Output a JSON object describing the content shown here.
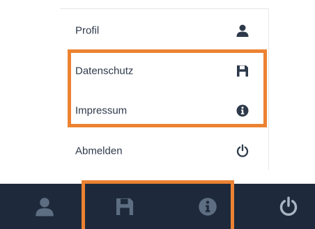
{
  "menu": {
    "items": [
      {
        "label": "Profil",
        "icon": "user-icon"
      },
      {
        "label": "Datenschutz",
        "icon": "floppy-disk-icon"
      },
      {
        "label": "Impressum",
        "icon": "info-circle-icon"
      },
      {
        "label": "Abmelden",
        "icon": "power-icon"
      }
    ]
  },
  "bottom_bar": {
    "buttons": [
      {
        "icon": "user-icon"
      },
      {
        "icon": "floppy-disk-icon"
      },
      {
        "icon": "info-circle-icon"
      },
      {
        "icon": "power-icon"
      }
    ]
  },
  "colors": {
    "highlight": "#ec8232",
    "bar_background": "#1e2a3b",
    "menu_icon": "#2e3a4b",
    "bar_icon_dim": "#5e6e82",
    "bar_icon_light": "#aab4c2"
  }
}
